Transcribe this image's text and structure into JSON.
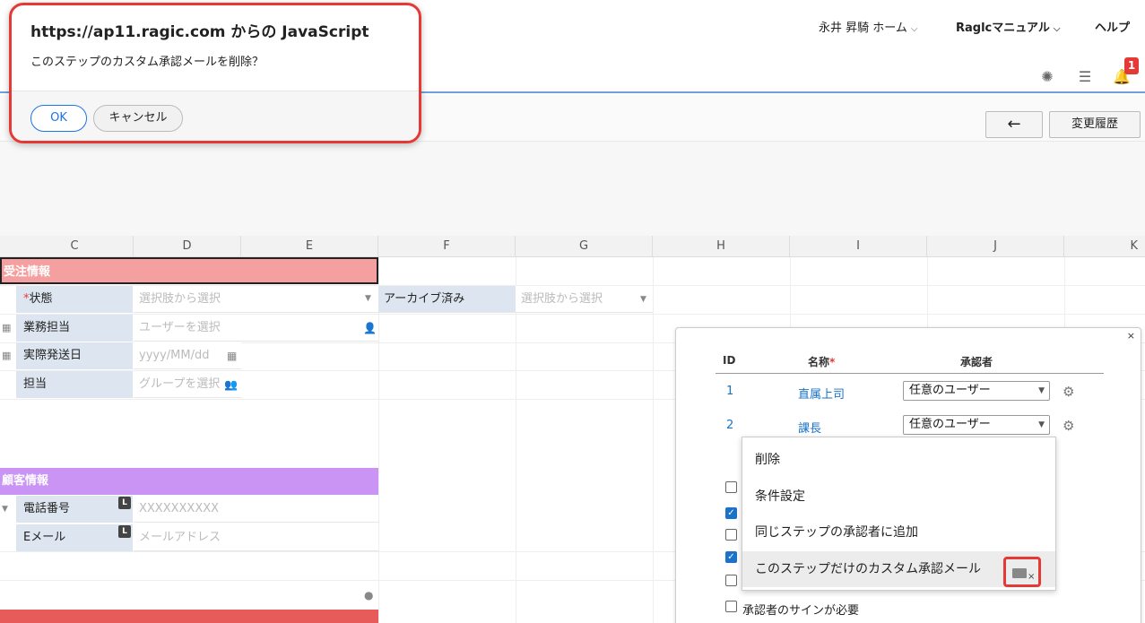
{
  "nav": {
    "user": "永井 昇騎 ホーム",
    "manual": "Raglcマニュアル",
    "help": "ヘルプ",
    "notification_count": "1"
  },
  "toolbar": {
    "back": "←",
    "history": "変更履歴"
  },
  "columns": [
    "C",
    "D",
    "E",
    "F",
    "G",
    "H",
    "I",
    "J",
    "K"
  ],
  "sections": {
    "order": "受注情報",
    "customer": "顧客情報"
  },
  "fields": {
    "status_label": "状態",
    "status_required": "*",
    "status_placeholder": "選択肢から選択",
    "archived_label": "アーカイブ済み",
    "archived_placeholder": "選択肢から選択",
    "staff_label": "業務担当",
    "staff_placeholder": "ユーザーを選択",
    "ship_date_label": "実際発送日",
    "ship_date_placeholder": "yyyy/MM/dd",
    "assignee_label": "担当",
    "assignee_placeholder": "グループを選択",
    "phone_label": "電話番号",
    "phone_placeholder": "XXXXXXXXXX",
    "email_label": "Eメール",
    "email_placeholder": "メールアドレス",
    "link_badge": "L"
  },
  "approval_panel": {
    "close": "×",
    "headers": {
      "id": "ID",
      "name": "名称",
      "name_required": "*",
      "approver": "承認者"
    },
    "steps": [
      {
        "id": "1",
        "name": "直属上司",
        "approver": "任意のユーザー"
      },
      {
        "id": "2",
        "name": "課長",
        "approver": "任意のユーザー"
      }
    ],
    "sign_required": "承認者のサインが必要"
  },
  "context_menu": {
    "items": [
      "削除",
      "条件設定",
      "同じステップの承認者に追加",
      "このステップだけのカスタム承認メール"
    ]
  },
  "dialog": {
    "title": "https://ap11.ragic.com からの JavaScript",
    "message": "このステップのカスタム承認メールを削除？",
    "ok": "OK",
    "cancel": "キャンセル"
  }
}
